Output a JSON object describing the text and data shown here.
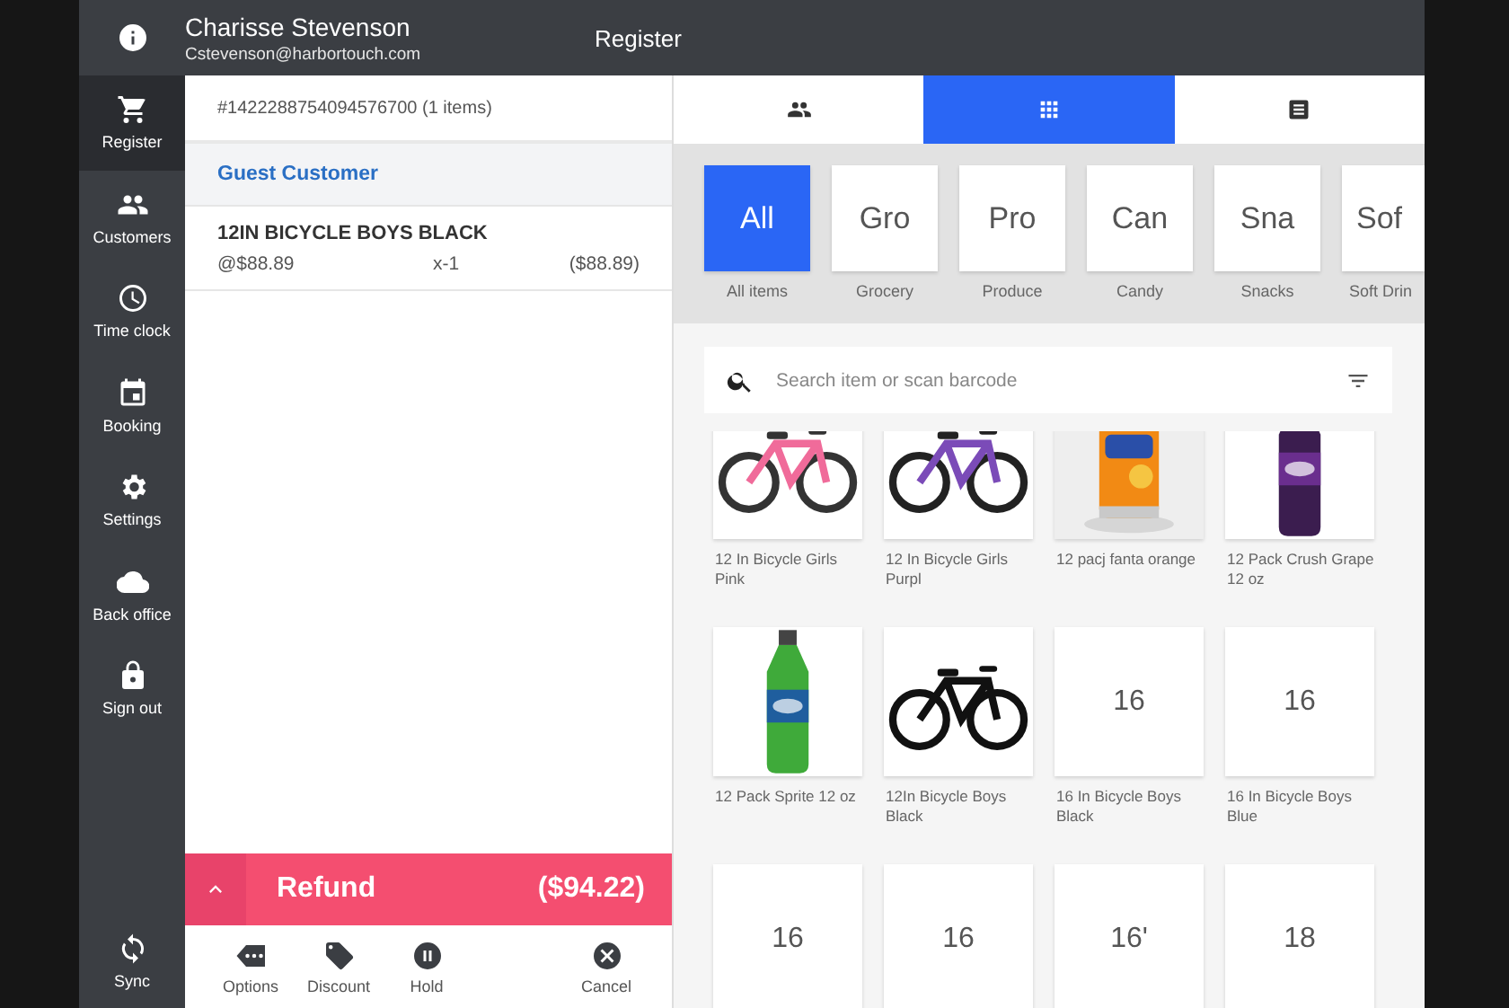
{
  "header": {
    "user_name": "Charisse Stevenson",
    "user_email": "Cstevenson@harbortouch.com",
    "title": "Register"
  },
  "sidebar": {
    "items": [
      {
        "label": "Register",
        "kind": "cart",
        "selected": true
      },
      {
        "label": "Customers",
        "kind": "people",
        "selected": false
      },
      {
        "label": "Time clock",
        "kind": "clock",
        "selected": false
      },
      {
        "label": "Booking",
        "kind": "calendar",
        "selected": false
      },
      {
        "label": "Settings",
        "kind": "gear",
        "selected": false
      },
      {
        "label": "Back office",
        "kind": "cloud",
        "selected": false
      },
      {
        "label": "Sign out",
        "kind": "lock",
        "selected": false
      }
    ],
    "bottom": {
      "label": "Sync",
      "kind": "sync"
    }
  },
  "order": {
    "number": "#1422288754094576700 (1 items)",
    "customer": "Guest Customer",
    "lines": [
      {
        "name": "12IN BICYCLE BOYS BLACK",
        "unit_price": "@$88.89",
        "quantity": "x-1",
        "total": "($88.89)"
      }
    ],
    "total_label": "Refund",
    "total": "($94.22)"
  },
  "actions": [
    {
      "label": "Options",
      "kind": "options"
    },
    {
      "label": "Discount",
      "kind": "tag"
    },
    {
      "label": "Hold",
      "kind": "pause"
    },
    {
      "label": "Cancel",
      "kind": "cancel"
    }
  ],
  "view_tabs": [
    {
      "kind": "people",
      "selected": false
    },
    {
      "kind": "grid",
      "selected": true
    },
    {
      "kind": "list",
      "selected": false
    }
  ],
  "categories": [
    {
      "tile": "All",
      "label": "All items",
      "selected": true
    },
    {
      "tile": "Gro",
      "label": "Grocery",
      "selected": false
    },
    {
      "tile": "Pro",
      "label": "Produce",
      "selected": false
    },
    {
      "tile": "Can",
      "label": "Candy",
      "selected": false
    },
    {
      "tile": "Sna",
      "label": "Snacks",
      "selected": false
    },
    {
      "tile": "Sof",
      "label": "Soft Drin",
      "selected": false
    }
  ],
  "search": {
    "placeholder": "Search item or scan barcode"
  },
  "products": [
    {
      "kind": "picture",
      "name": "12 In Bicycle Girls Pink"
    },
    {
      "kind": "picture",
      "name": "12 In Bicycle Girls Purpl"
    },
    {
      "kind": "picture",
      "name": "12 pacj fanta orange"
    },
    {
      "kind": "picture",
      "name": "12 Pack Crush Grape 12 oz"
    },
    {
      "kind": "picture",
      "name": "12 Pack Sprite 12 oz"
    },
    {
      "kind": "picture",
      "name": "12In Bicycle Boys Black"
    },
    {
      "kind": "tile",
      "tile": "16",
      "name": "16 In Bicycle Boys Black"
    },
    {
      "kind": "tile",
      "tile": "16",
      "name": "16 In Bicycle Boys Blue"
    },
    {
      "kind": "tile",
      "tile": "16"
    },
    {
      "kind": "tile",
      "tile": "16"
    },
    {
      "kind": "tile",
      "tile": "16'"
    },
    {
      "kind": "tile",
      "tile": "18"
    }
  ]
}
